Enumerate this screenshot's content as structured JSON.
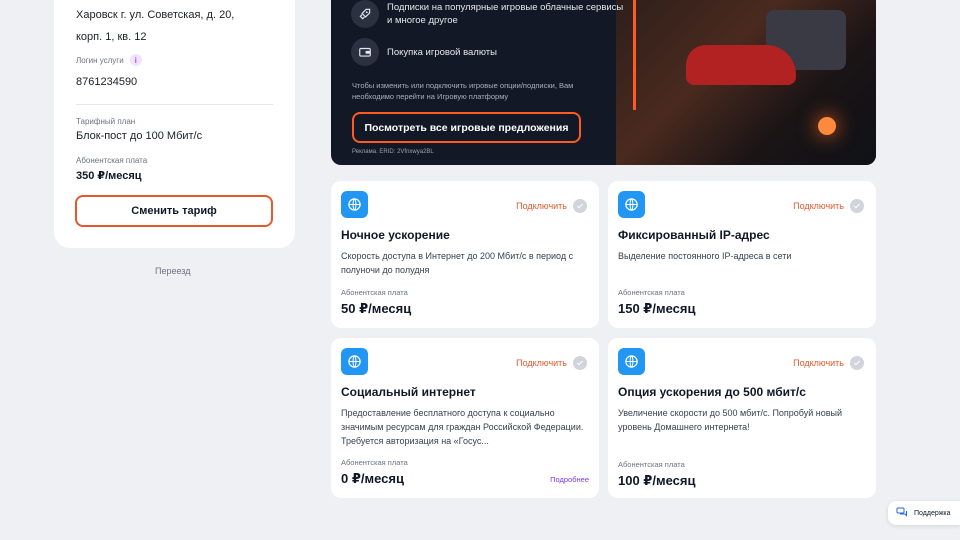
{
  "account": {
    "address_line1": "Харовск г. ул. Советская, д. 20,",
    "address_line2": "корп. 1, кв. 12",
    "login_label": "Логин услуги",
    "login_value": "8761234590",
    "tariff_label": "Тарифный план",
    "tariff_value": "Блок-пост до 100 Мбит/с",
    "fee_label": "Абонентская плата",
    "fee_value": "350 ₽/месяц",
    "change_button": "Сменить тариф",
    "move_link": "Переезд"
  },
  "banner": {
    "feature1": "Подписки на популярные игровые облачные сервисы и многое другое",
    "feature2": "Покупка игровой валюты",
    "notice": "Чтобы изменить или подключить игровые опции/подписки, Вам необходимо перейти на Игровую платформу",
    "button": "Посмотреть все игровые предложения",
    "ad": "Реклама. ERID: 2Vfnxwya2BL"
  },
  "options": [
    {
      "title": "Ночное ускорение",
      "desc": "Скорость доступа в Интернет до 200 Мбит/с в период с полуночи до полудня",
      "fee_label": "Абонентская плата",
      "price": "50 ₽/месяц",
      "connect": "Подключить"
    },
    {
      "title": "Фиксированный IP-адрес",
      "desc": "Выделение постоянного IP-адреса в сети",
      "fee_label": "Абонентская плата",
      "price": "150 ₽/месяц",
      "connect": "Подключить"
    },
    {
      "title": "Социальный интернет",
      "desc": "Предоставление бесплатного доступа к социально значимым ресурсам для граждан Российской Федерации. Требуется авторизация на «Госус...",
      "fee_label": "Абонентская плата",
      "price": "0 ₽/месяц",
      "connect": "Подключить",
      "more": "Подробнее"
    },
    {
      "title": "Опция ускорения до 500 мбит/с",
      "desc": "Увеличение скорости до 500 мбит/с. Попробуй новый уровень Домашнего интернета!",
      "fee_label": "Абонентская плата",
      "price": "100 ₽/месяц",
      "connect": "Подключить"
    }
  ],
  "support": {
    "label": "Поддержка"
  },
  "colors": {
    "accent": "#e15a2e",
    "banner_bg": "#121826",
    "icon_blue": "#2196f3",
    "link_purple": "#7c3aed"
  },
  "icons": [
    "rocket-icon",
    "wallet-icon",
    "globe-icon",
    "check-icon",
    "chat-icon",
    "info-icon"
  ]
}
